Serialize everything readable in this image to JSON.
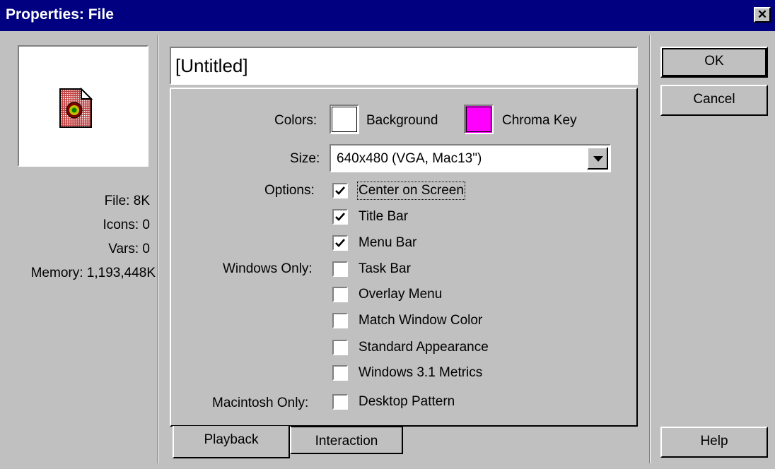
{
  "window": {
    "title": "Properties: File",
    "close_glyph": "✕"
  },
  "preview": {
    "icon": "file-document-icon"
  },
  "stats": [
    {
      "label": "File:",
      "value": "8K"
    },
    {
      "label": "Icons:",
      "value": "0"
    },
    {
      "label": "Vars:",
      "value": "0"
    },
    {
      "label": "Memory:",
      "value": "1,193,448K"
    }
  ],
  "file_title": {
    "value": "[Untitled]"
  },
  "playback": {
    "colors_label": "Colors:",
    "background_label": "Background",
    "background_color": "#ffffff",
    "chroma_label": "Chroma Key",
    "chroma_color": "#ff00ff",
    "size_label": "Size:",
    "size_value": "640x480 (VGA, Mac13\")",
    "options_label": "Options:",
    "windows_only_label": "Windows Only:",
    "mac_only_label": "Macintosh Only:",
    "options": [
      {
        "label": "Center on Screen",
        "checked": true
      },
      {
        "label": "Title Bar",
        "checked": true
      },
      {
        "label": "Menu Bar",
        "checked": true
      }
    ],
    "windows_options": [
      {
        "label": "Task Bar",
        "checked": false
      },
      {
        "label": "Overlay Menu",
        "checked": false
      },
      {
        "label": "Match Window Color",
        "checked": false
      },
      {
        "label": "Standard Appearance",
        "checked": false
      },
      {
        "label": "Windows 3.1 Metrics",
        "checked": false
      }
    ],
    "mac_options": [
      {
        "label": "Desktop Pattern",
        "checked": false
      }
    ]
  },
  "tabs": [
    {
      "label": "Playback",
      "active": true
    },
    {
      "label": "Interaction",
      "active": false
    }
  ],
  "buttons": {
    "ok": "OK",
    "cancel": "Cancel",
    "help": "Help"
  }
}
